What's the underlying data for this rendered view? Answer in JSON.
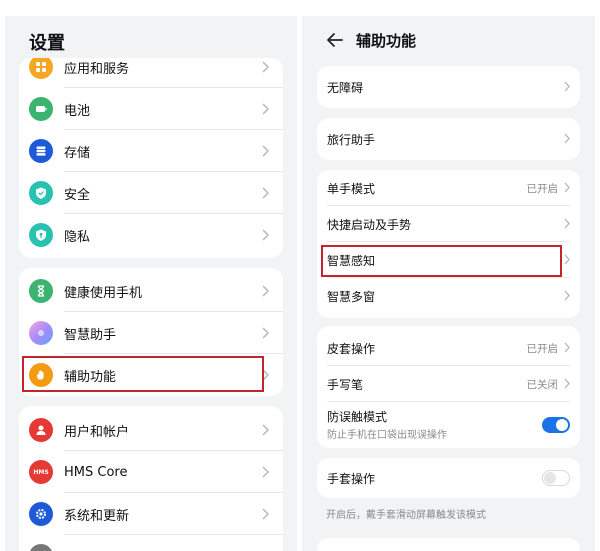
{
  "left": {
    "title": "设置",
    "items": [
      {
        "label": "应用和服务",
        "icon": "apps-icon",
        "color": "#f5a623"
      },
      {
        "label": "电池",
        "icon": "battery-icon",
        "color": "#3cb371"
      },
      {
        "label": "存储",
        "icon": "storage-icon",
        "color": "#1e5ad8"
      },
      {
        "label": "安全",
        "icon": "shield-check-icon",
        "color": "#27c3b0"
      },
      {
        "label": "隐私",
        "icon": "privacy-icon",
        "color": "#27c3b0"
      },
      {
        "label": "健康使用手机",
        "icon": "hourglass-icon",
        "color": "#3cb371"
      },
      {
        "label": "智慧助手",
        "icon": "assistant-icon",
        "color": "#a78bfa"
      },
      {
        "label": "辅助功能",
        "icon": "hand-icon",
        "color": "#f39c12"
      },
      {
        "label": "用户和帐户",
        "icon": "user-icon",
        "color": "#e53935"
      },
      {
        "label": "HMS Core",
        "icon": "hms-icon",
        "color": "#e53935",
        "badge": "HMS"
      },
      {
        "label": "系统和更新",
        "icon": "gear-icon",
        "color": "#1e5ad8"
      }
    ]
  },
  "right": {
    "title": "辅助功能",
    "rows": [
      {
        "label": "无障碍"
      },
      {
        "label": "旅行助手"
      },
      {
        "label": "单手模式",
        "value": "已开启"
      },
      {
        "label": "快捷启动及手势"
      },
      {
        "label": "智慧感知"
      },
      {
        "label": "智慧多窗"
      },
      {
        "label": "皮套操作",
        "value": "已开启"
      },
      {
        "label": "手写笔",
        "value": "已关闭"
      },
      {
        "label": "防误触模式",
        "sub": "防止手机在口袋出现误操作",
        "toggle": "on"
      },
      {
        "label": "手套操作",
        "toggle": "off"
      }
    ],
    "footer": "开启后，戴手套滑动屏幕触发该模式"
  },
  "colors": {
    "accent": "#1a73e8",
    "highlight": "#c0262b"
  }
}
